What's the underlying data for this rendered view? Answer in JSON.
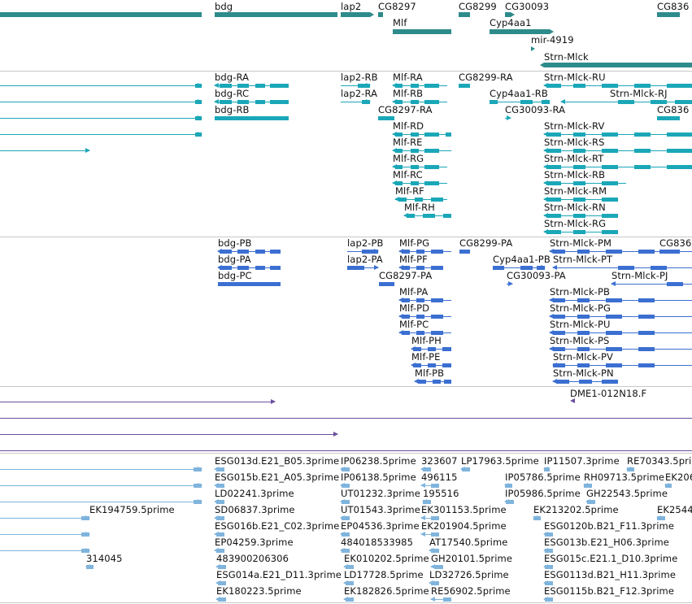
{
  "colors": {
    "gene": "#2e8b8b",
    "transcript_teal": "#1aa7b8",
    "transcript_blue": "#3b6fd1",
    "clone": "#6c4f9e",
    "est": "#7fb4dd",
    "separator": "#c8c8c8"
  },
  "tracks": {
    "genes": {
      "labels": [
        "bdg",
        "lap2",
        "CG8297",
        "CG8299",
        "CG30093",
        "CG836",
        "Mlf",
        "Cyp4aa1",
        "mir-4919",
        "Strn-Mlck"
      ]
    },
    "transcripts_teal": {
      "labels": [
        "bdg-RA",
        "lap2-RB",
        "Mlf-RA",
        "CG8299-RA",
        "Strn-Mlck-RU",
        "bdg-RC",
        "lap2-RA",
        "Mlf-RB",
        "Cyp4aa1-RB",
        "Strn-Mlck-RJ",
        "bdg-RB",
        "CG8297-RA",
        "CG30093-RA",
        "CG836",
        "Mlf-RD",
        "Strn-Mlck-RV",
        "Mlf-RE",
        "Strn-Mlck-RS",
        "Mlf-RG",
        "Strn-Mlck-RT",
        "Mlf-RC",
        "Strn-Mlck-RB",
        "Mlf-RF",
        "Strn-Mlck-RM",
        "Mlf-RH",
        "Strn-Mlck-RN",
        "Strn-Mlck-RG"
      ]
    },
    "transcripts_blue": {
      "labels": [
        "bdg-PB",
        "lap2-PB",
        "Mlf-PG",
        "CG8299-PA",
        "Strn-Mlck-PM",
        "CG836",
        "bdg-PA",
        "lap2-PA",
        "Mlf-PF",
        "Cyp4aa1-PB",
        "Strn-Mlck-PT",
        "bdg-PC",
        "CG8297-PA",
        "CG30093-PA",
        "Strn-Mlck-PJ",
        "Mlf-PA",
        "Strn-Mlck-PB",
        "Mlf-PD",
        "Strn-Mlck-PG",
        "Mlf-PC",
        "Strn-Mlck-PU",
        "Mlf-PH",
        "Strn-Mlck-PS",
        "Mlf-PE",
        "Strn-Mlck-PV",
        "Mlf-PB",
        "Strn-Mlck-PN"
      ]
    },
    "clones": {
      "labels": [
        "DME1-012N18.F"
      ]
    },
    "ests": {
      "labels": [
        "ESG013d.E21_B05.3prime",
        "IP06238.5prime",
        "323607",
        "LP17963.5prime",
        "IP11507.3prime",
        "RE70343.5prime",
        "ESG015b.E21_A05.3prime",
        "IP06138.5prime",
        "496115",
        "IP05786.5prime",
        "RH09713.5prime",
        "EK206",
        "LD02241.3prime",
        "UT01232.3prime",
        "195516",
        "IP05986.5prime",
        "GH22543.5prime",
        "EK194759.5prime",
        "SD06837.3prime",
        "UT01543.3prime",
        "EK301153.5prime",
        "EK213202.5prime",
        "EK2544",
        "ESG016b.E21_C02.3prime",
        "EP04536.3prime",
        "EK201904.5prime",
        "ESG0120b.B21_F11.3prime",
        "EP04259.3prime",
        "484018533985",
        "AT17540.5prime",
        "ESG013b.E21_H06.3prime",
        "314045",
        "483900206306",
        "EK010202.5prime",
        "GH20101.5prime",
        "ESG015c.E21.1_D10.3prime",
        "ESG014a.E21_D11.3prime",
        "LD17728.5prime",
        "LD32726.5prime",
        "ESG0113d.B21_H11.3prime",
        "EK180223.5prime",
        "EK182826.5prime",
        "RE56902.5prime",
        "ESG0115b.B21_F12.3prime"
      ]
    }
  }
}
